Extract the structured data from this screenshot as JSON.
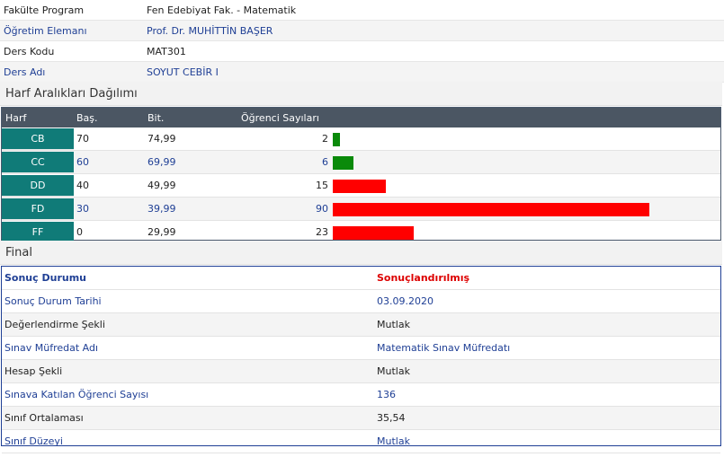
{
  "course_info": [
    {
      "label": "Fakülte Program",
      "value": "Fen Edebiyat Fak. - Matematik",
      "blue": false
    },
    {
      "label": "Öğretim Elemanı",
      "value": "Prof. Dr. MUHİTTİN BAŞER",
      "blue": true
    },
    {
      "label": "Ders Kodu",
      "value": "MAT301",
      "blue": false
    },
    {
      "label": "Ders Adı",
      "value": "SOYUT CEBİR I",
      "blue": true
    }
  ],
  "grade_section": {
    "title": "Harf Aralıkları Dağılımı",
    "headers": {
      "harf": "Harf",
      "bas": "Baş.",
      "bit": "Bit.",
      "ogrenci": "Öğrenci Sayıları"
    },
    "rows": [
      {
        "harf": "CB",
        "bas": "70",
        "bit": "74,99",
        "count": "2",
        "bar_color": "#0a8a0a"
      },
      {
        "harf": "CC",
        "bas": "60",
        "bit": "69,99",
        "count": "6",
        "bar_color": "#0a8a0a"
      },
      {
        "harf": "DD",
        "bas": "40",
        "bit": "49,99",
        "count": "15",
        "bar_color": "#ff0000"
      },
      {
        "harf": "FD",
        "bas": "30",
        "bit": "39,99",
        "count": "90",
        "bar_color": "#ff0000"
      },
      {
        "harf": "FF",
        "bas": "0",
        "bit": "29,99",
        "count": "23",
        "bar_color": "#ff0000"
      }
    ]
  },
  "final_section": {
    "title": "Final",
    "heading": {
      "label": "Sonuç Durumu",
      "value": "Sonuçlandırılmış"
    },
    "rows": [
      {
        "label": "Sonuç Durum Tarihi",
        "value": "03.09.2020",
        "blue": true
      },
      {
        "label": "Değerlendirme Şekli",
        "value": "Mutlak",
        "blue": false
      },
      {
        "label": "Sınav Müfredat Adı",
        "value": "Matematik Sınav Müfredatı",
        "blue": true
      },
      {
        "label": "Hesap Şekli",
        "value": "Mutlak",
        "blue": false
      },
      {
        "label": "Sınava Katılan Öğrenci Sayısı",
        "value": "136",
        "blue": true
      },
      {
        "label": "Sınıf Ortalaması",
        "value": "35,54",
        "blue": false
      },
      {
        "label": "Sınıf Düzeyi",
        "value": "Mutlak",
        "blue": true
      }
    ]
  },
  "colors": {
    "header_bg": "#4b5663",
    "harf_cell": "#107b78",
    "link_blue": "#1f3f95",
    "status_red": "#dd0000"
  }
}
